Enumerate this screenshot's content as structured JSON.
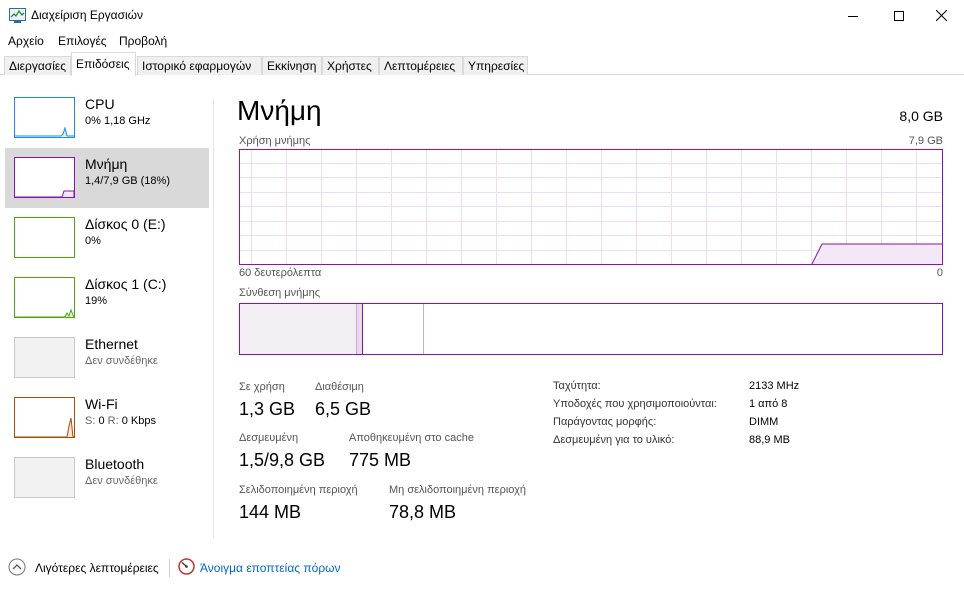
{
  "window": {
    "title": "Διαχείριση Εργασιών"
  },
  "menu": [
    "Αρχείο",
    "Επιλογές",
    "Προβολή"
  ],
  "tabs": [
    {
      "label": "Διεργασίες"
    },
    {
      "label": "Επιδόσεις",
      "active": true
    },
    {
      "label": "Ιστορικό εφαρμογών"
    },
    {
      "label": "Εκκίνηση"
    },
    {
      "label": "Χρήστες"
    },
    {
      "label": "Λεπτομέρειες"
    },
    {
      "label": "Υπηρεσίες"
    }
  ],
  "sidebar": {
    "items": [
      {
        "name": "CPU",
        "sub": "0%  1,18 GHz",
        "color": "#1f8dd6"
      },
      {
        "name": "Μνήμη",
        "sub": "1,4/7,9 GB (18%)",
        "color": "#8b12ae",
        "selected": true
      },
      {
        "name": "Δίσκος 0 (E:)",
        "sub": "0%",
        "color": "#4da60c"
      },
      {
        "name": "Δίσκος 1 (C:)",
        "sub": "19%",
        "color": "#4da60c"
      },
      {
        "name": "Ethernet",
        "sub": "Δεν συνδέθηκε",
        "color": "#a0a0a0"
      },
      {
        "name": "Wi-Fi",
        "sub_s_label": "S:",
        "sub_s_value": "0",
        "sub_r_label": "R:",
        "sub_r_value": "0 Kbps",
        "color": "#a74f01"
      },
      {
        "name": "Bluetooth",
        "sub": "Δεν συνδέθηκε",
        "color": "#a0a0a0"
      }
    ]
  },
  "memory": {
    "title": "Μνήμη",
    "total": "8,0 GB",
    "usage_label": "Χρήση μνήμης",
    "usage_max": "7,9 GB",
    "time_left": "60 δευτερόλεπτα",
    "time_right": "0",
    "composition_label": "Σύνθεση μνήμης",
    "accent": "#8b12ae",
    "in_use_label": "Σε χρήση",
    "in_use_value": "1,3 GB",
    "available_label": "Διαθέσιμη",
    "available_value": "6,5 GB",
    "committed_label": "Δεσμευμένη",
    "committed_value": "1,5/9,8 GB",
    "cached_label": "Αποθηκευμένη στο cache",
    "cached_value": "775 MB",
    "paged_label": "Σελιδοποιημένη περιοχή",
    "paged_value": "144 MB",
    "nonpaged_label": "Μη σελιδοποιημένη περιοχή",
    "nonpaged_value": "78,8 MB",
    "details": [
      {
        "label": "Ταχύτητα:",
        "value": "2133 MHz"
      },
      {
        "label": "Υποδοχές που χρησιμοποιούνται:",
        "value": "1 από 8"
      },
      {
        "label": "Παράγοντας μορφής:",
        "value": "DIMM"
      },
      {
        "label": "Δεσμευμένη για το υλικό:",
        "value": "88,9 MB"
      }
    ]
  },
  "footer": {
    "less_details": "Λιγότερες λεπτομέρειες",
    "resource_monitor": "Άνοιγμα εποπτείας πόρων"
  }
}
